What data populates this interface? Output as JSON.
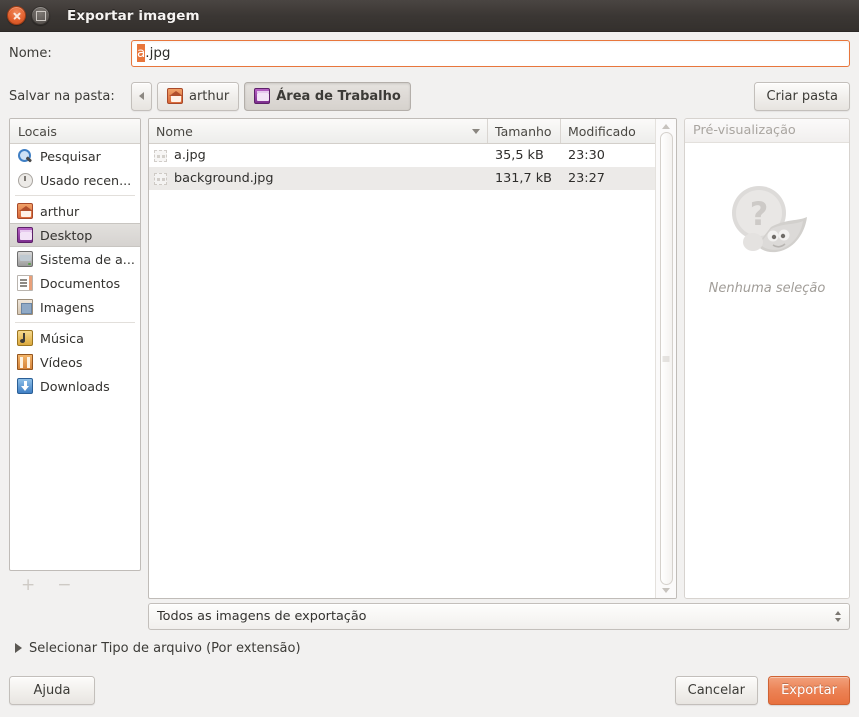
{
  "window": {
    "title": "Exportar imagem",
    "close_icon": "close-icon",
    "maximize_icon": "maximize-icon"
  },
  "name_row": {
    "label": "Nome:",
    "value_selected": "a",
    "value_rest": ".jpg",
    "full_value": "a.jpg"
  },
  "path_row": {
    "label": "Salvar na pasta:",
    "back_icon": "chevron-left-icon",
    "crumbs": [
      {
        "label": "arthur",
        "icon": "home-folder-icon",
        "active": false
      },
      {
        "label": "Área de Trabalho",
        "icon": "desktop-icon",
        "active": true
      }
    ],
    "create_folder_label": "Criar pasta"
  },
  "sidebar": {
    "header": "Locais",
    "items": [
      {
        "label": "Pesquisar",
        "icon": "search-icon",
        "selected": false,
        "sep_after": false
      },
      {
        "label": "Usado recen...",
        "icon": "recent-icon",
        "selected": false,
        "sep_after": true
      },
      {
        "label": "arthur",
        "icon": "home-icon",
        "selected": false,
        "sep_after": false
      },
      {
        "label": "Desktop",
        "icon": "desktop-icon",
        "selected": true,
        "sep_after": false
      },
      {
        "label": "Sistema de a...",
        "icon": "drive-icon",
        "selected": false,
        "sep_after": false
      },
      {
        "label": "Documentos",
        "icon": "documents-icon",
        "selected": false,
        "sep_after": false
      },
      {
        "label": "Imagens",
        "icon": "pictures-icon",
        "selected": false,
        "sep_after": true
      },
      {
        "label": "Música",
        "icon": "music-icon",
        "selected": false,
        "sep_after": false
      },
      {
        "label": "Vídeos",
        "icon": "video-icon",
        "selected": false,
        "sep_after": false
      },
      {
        "label": "Downloads",
        "icon": "download-icon",
        "selected": false,
        "sep_after": false
      }
    ],
    "add_label": "+",
    "remove_label": "−"
  },
  "filelist": {
    "columns": [
      {
        "key": "name",
        "label": "Nome",
        "sort": "descending"
      },
      {
        "key": "size",
        "label": "Tamanho",
        "sort": null
      },
      {
        "key": "mod",
        "label": "Modificado",
        "sort": null
      }
    ],
    "rows": [
      {
        "name": "a.jpg",
        "size": "35,5 kB",
        "mod": "23:30",
        "icon": "broken-image-icon",
        "highlighted": false
      },
      {
        "name": "background.jpg",
        "size": "131,7 kB",
        "mod": "23:27",
        "icon": "broken-image-icon",
        "highlighted": true
      }
    ],
    "scrollbar": {
      "up_icon": "scroll-up-icon",
      "down_icon": "scroll-down-icon",
      "grip_icon": "scrollbar-grip-icon"
    }
  },
  "preview": {
    "header": "Pré-visualização",
    "empty_text": "Nenhuma seleção",
    "icon": "wilber-unknown-icon"
  },
  "filter": {
    "selected": "Todos as imagens de exportação",
    "up_icon": "spinner-up-icon",
    "down_icon": "spinner-down-icon"
  },
  "expander": {
    "label": "Selecionar Tipo de arquivo (Por extensão)",
    "icon": "expander-collapsed-icon",
    "expanded": false
  },
  "actions": {
    "help": "Ajuda",
    "cancel": "Cancelar",
    "export": "Exportar"
  },
  "colors": {
    "accent": "#e8763c",
    "titlebar": "#3b3734",
    "window_bg": "#f2f1f0",
    "export_button": "#ec8356",
    "selection": "#d6d3d0"
  }
}
